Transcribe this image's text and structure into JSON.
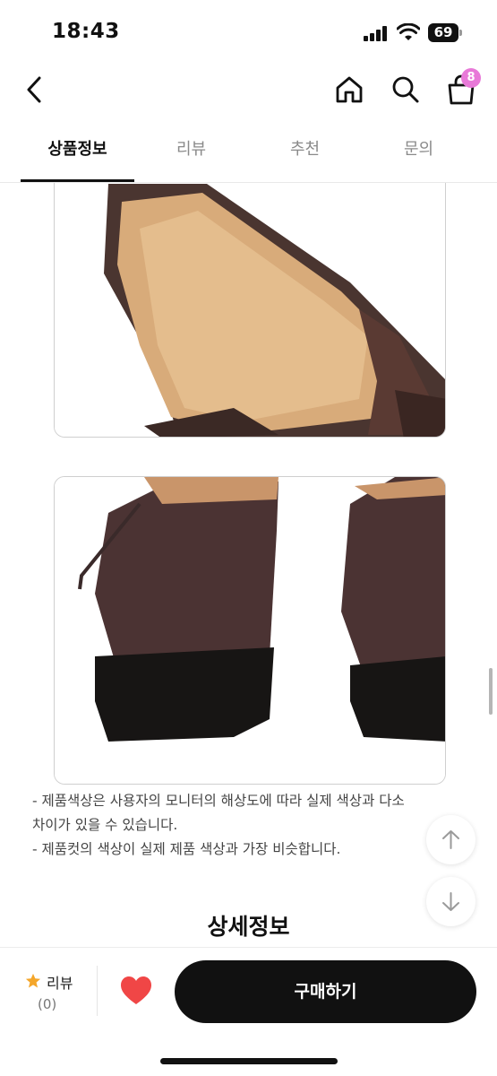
{
  "status_bar": {
    "time": "18:43",
    "battery": "69"
  },
  "header": {
    "back_icon": "chevron-left-icon",
    "home_icon": "home-icon",
    "search_icon": "search-icon",
    "cart_icon": "shopping-bag-icon",
    "cart_count": "8",
    "badge_color": "#e879d8"
  },
  "tabs": [
    {
      "label": "상품정보",
      "active": true
    },
    {
      "label": "리뷰",
      "active": false
    },
    {
      "label": "추천",
      "active": false
    },
    {
      "label": "문의",
      "active": false
    }
  ],
  "content": {
    "images": [
      "shoe-interior-photo",
      "shoe-heels-photo"
    ],
    "notice_lines": [
      "- 제품색상은 사용자의 모니터의 해상도에 따라 실제 색상과 다소",
      "차이가 있을 수 있습니다.",
      "- 제품컷의 색상이 실제 제품 색상과 가장 비슷합니다."
    ],
    "section_title": "상세정보"
  },
  "floating": {
    "up_icon": "arrow-up-icon",
    "down_icon": "arrow-down-icon"
  },
  "bottom_bar": {
    "review_label": "리뷰",
    "review_count": "(0)",
    "buy_label": "구매하기",
    "star_color": "#f4a62a",
    "heart_color": "#f04646",
    "buy_color": "#111111"
  }
}
